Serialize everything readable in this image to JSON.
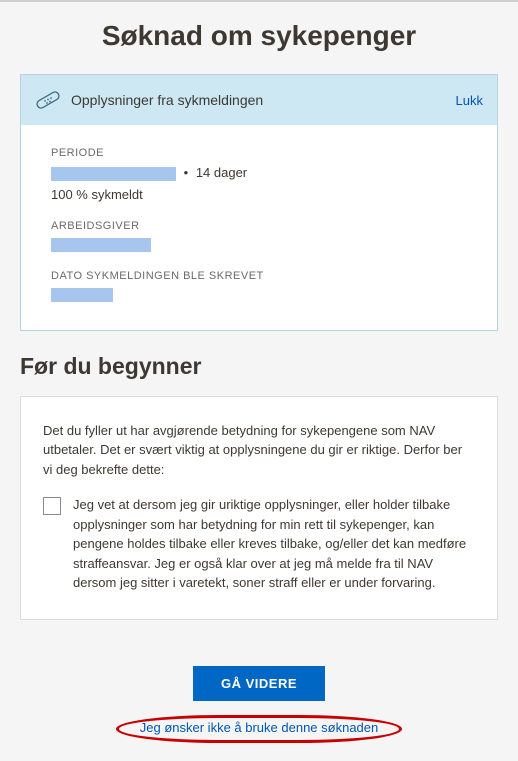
{
  "page": {
    "title": "Søknad om sykepenger"
  },
  "info_panel": {
    "header": "Opplysninger fra sykmeldingen",
    "close_label": "Lukk",
    "period_label": "PERIODE",
    "period_suffix": "14 dager",
    "period_separator": "•",
    "percent_text": "100 % sykmeldt",
    "employer_label": "ARBEIDSGIVER",
    "date_written_label": "DATO SYKMELDINGEN BLE SKREVET"
  },
  "before_section": {
    "title": "Før du begynner",
    "intro": "Det du fyller ut har avgjørende betydning for sykepengene som NAV utbetaler. Det er svært viktig at opplysningene du gir er riktige. Derfor ber vi deg bekrefte dette:",
    "checkbox_label": "Jeg vet at dersom jeg gir uriktige opplysninger, eller holder tilbake opplysninger som har betydning for min rett til sykepenger, kan pengene holdes tilbake eller kreves tilbake, og/eller det kan medføre straffeansvar. Jeg er også klar over at jeg må melde fra til NAV dersom jeg sitter i varetekt, soner straff eller er under forvaring."
  },
  "actions": {
    "primary": "GÅ VIDERE",
    "secondary": "Jeg ønsker ikke å bruke denne søknaden"
  }
}
